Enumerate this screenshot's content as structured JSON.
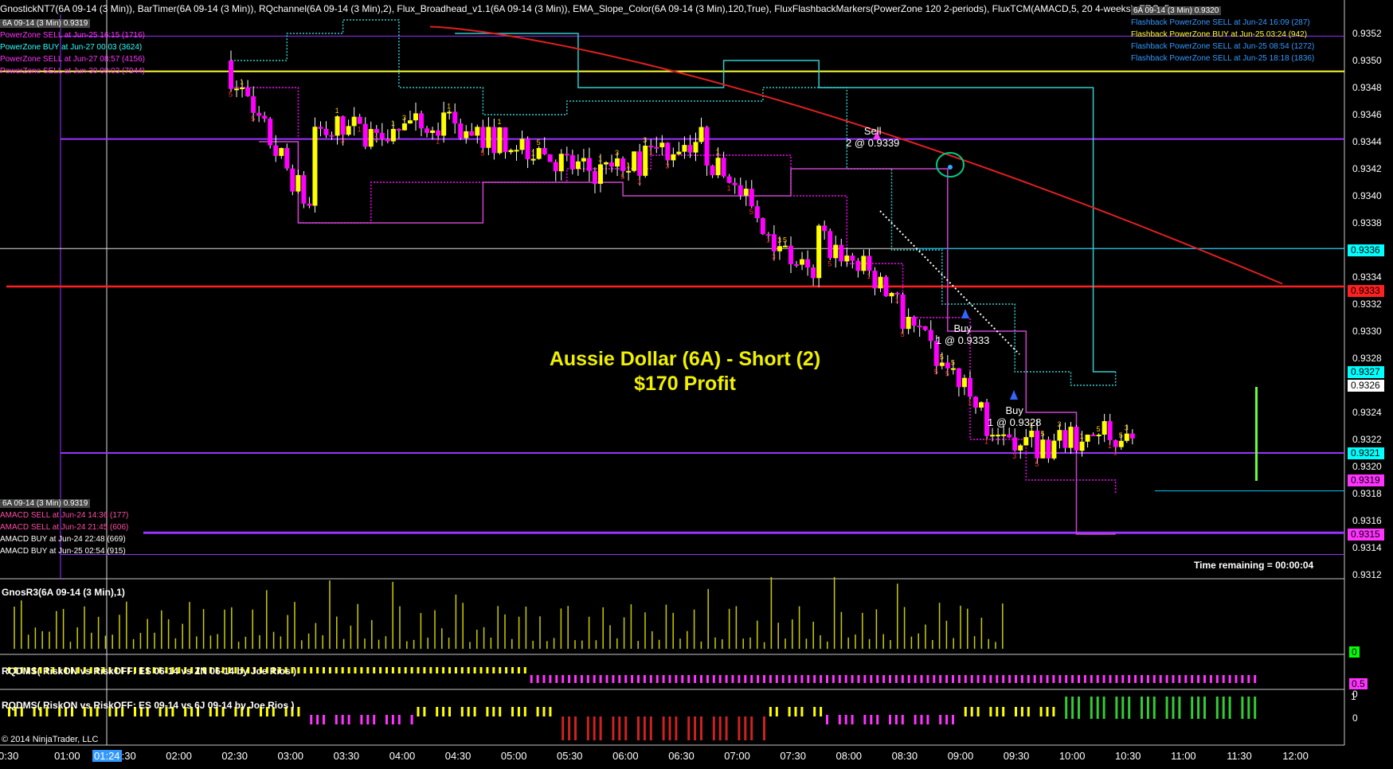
{
  "header": {
    "indicators_line": "GnostickNT7(6A 09-14 (3 Min)),  BarTimer(6A 09-14 (3 Min)),  RQchannel(6A 09-14 (3 Min),2),  Flux_Broadhead_v1.1(6A 09-14 (3 Min)),  EMA_Slope_Color(6A 09-14 (3 Min),120,True),  FluxFlashbackMarkers(PowerZone 120 2-periods),  FluxTCM(AMACD,5, 20 4-weeks),  FRC_5"
  },
  "powerzone_annotations": [
    {
      "text": "6A 09-14 (3 Min) 0.9319",
      "color": "#ffffff"
    },
    {
      "text": "PowerZone SELL at Jun-25 16:15 (1716)",
      "color": "#ff33ff"
    },
    {
      "text": "PowerZone BUY at Jun-27 00:03 (3624)",
      "color": "#33ffff"
    },
    {
      "text": "PowerZone SELL at Jun-27 08:57 (4156)",
      "color": "#ff33ff"
    },
    {
      "text": "PowerZone SELL at Jun-30 00:03 (7944)",
      "color": "#ff33ff"
    }
  ],
  "flashback_annotations": [
    {
      "text": "6A 09-14 (3 Min) 0.9320",
      "color": "#ffffff"
    },
    {
      "text": "Flashback PowerZone SELL at Jun-24 16:09 (287)",
      "color": "#3399ff"
    },
    {
      "text": "Flashback PowerZone BUY at Jun-25 03:24 (942)",
      "color": "#ffff33"
    },
    {
      "text": "Flashback PowerZone SELL at Jun-25 08:54 (1272)",
      "color": "#3399ff"
    },
    {
      "text": "Flashback PowerZone SELL at Jun-25 18:18 (1836)",
      "color": "#3399ff"
    }
  ],
  "amacd_annotations": [
    {
      "text": "6A 09-14 (3 Min) 0.9319",
      "color": "#ffffff"
    },
    {
      "text": "AMACD SELL at Jun-24 14:36 (177)",
      "color": "#ff4da6"
    },
    {
      "text": "AMACD SELL at Jun-24 21:45 (606)",
      "color": "#ff4da6"
    },
    {
      "text": "AMACD BUY at Jun-24 22:48 (669)",
      "color": "#ffffff"
    },
    {
      "text": "AMACD BUY at Jun-25 02:54 (915)",
      "color": "#ffffff"
    }
  ],
  "headline": {
    "line1": "Aussie Dollar (6A) - Short (2)",
    "line2": "$170 Profit"
  },
  "trades": [
    {
      "label": "Sell",
      "detail": "2 @ 0.9339"
    },
    {
      "label": "Buy",
      "detail": "1 @ 0.9333"
    },
    {
      "label": "Buy",
      "detail": "1 @ 0.9328"
    }
  ],
  "time_remaining": "Time remaining = 00:00:04",
  "panels": {
    "gnos": "GnosR3(6A 09-14 (3 Min),1)",
    "rqdms1": "RQDMS( RiskON vs RiskOFF: ES 06-14 vs ZN 06-14  by Joe Rios  )",
    "rqdms2": "RQDMS( RiskON vs RiskOFF: ES 09-14 vs 6J 09-14  by Joe Rios  )"
  },
  "price_axis": [
    "0.9352",
    "0.9350",
    "0.9348",
    "0.9346",
    "0.9344",
    "0.9342",
    "0.9340",
    "0.9338",
    "0.9336",
    "0.9334",
    "0.9332",
    "0.9330",
    "0.9328",
    "0.9326",
    "0.9324",
    "0.9322",
    "0.9320",
    "0.9318",
    "0.9316",
    "0.9314",
    "0.9312"
  ],
  "price_tags": [
    {
      "value": "0.9336",
      "color": "#00ffff"
    },
    {
      "value": "0.9333",
      "color": "#ff2020"
    },
    {
      "value": "0.9327",
      "color": "#00ffff"
    },
    {
      "value": "0.9326",
      "color": "#ffffff"
    },
    {
      "value": "0.9321",
      "color": "#00ffff"
    },
    {
      "value": "0.9319",
      "color": "#ff33ff"
    },
    {
      "value": "0.9315",
      "color": "#ff33ff"
    }
  ],
  "indicator_axis": {
    "gnos_tag": "0",
    "rq1_tag": "0.5",
    "rq1_zero": "0",
    "rq2_one": "1",
    "rq2_zero": "0"
  },
  "time_axis": [
    "0:30",
    "01:00",
    "01:30",
    "02:00",
    "02:30",
    "03:00",
    "03:30",
    "04:00",
    "04:30",
    "05:00",
    "05:30",
    "06:00",
    "06:30",
    "07:00",
    "07:30",
    "08:00",
    "08:30",
    "09:00",
    "09:30",
    "10:00",
    "10:30",
    "11:00",
    "11:30",
    "12:00"
  ],
  "cursor_time": "01:24",
  "copyright": "© 2014 NinjaTrader, LLC",
  "colors": {
    "bull_bar": "#ffff00",
    "bear_bar": "#ff00ff",
    "ema": "#e02020",
    "channel": "#33cccc",
    "band": "#cc33ff",
    "zone_line": "#9933ff"
  }
}
